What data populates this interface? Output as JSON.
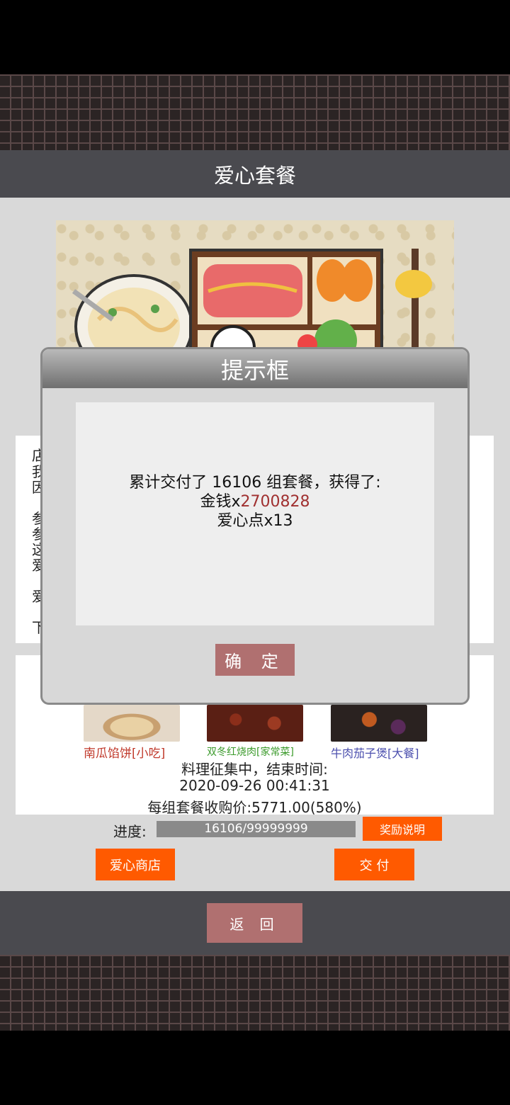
{
  "header": {
    "title": "爱心套餐"
  },
  "description_lines": [
    "店",
    "我",
    "因",
    "参",
    "参",
    "这",
    "爱",
    "爱",
    "下"
  ],
  "dishes": [
    {
      "name": "南瓜馅饼[小吃]",
      "color": "#c0392b"
    },
    {
      "name": "双冬红烧肉[家常菜]",
      "color": "#3a9a2a"
    },
    {
      "name": "牛肉茄子煲[大餐]",
      "color": "#4b4fae"
    }
  ],
  "collection": {
    "status": "料理征集中，结束时间:",
    "end_time": "2020-09-26 00:41:31",
    "price_line": "每组套餐收购价:5771.00(580%)"
  },
  "progress": {
    "label": "进度:",
    "text": "16106/99999999",
    "value": 16106,
    "max": 99999999
  },
  "buttons": {
    "reward_info": "奖励说明",
    "love_shop": "爱心商店",
    "deliver": "交 付",
    "back": "返 回"
  },
  "dialog": {
    "title": "提示框",
    "line1": "累计交付了 16106 组套餐，获得了:",
    "money_label": "金钱x",
    "money_value": "2700828",
    "love_points": "爱心点x13",
    "ok": "确 定"
  },
  "colors": {
    "accent_orange": "#ff5a00",
    "dusty_rose": "#b07070",
    "money_red": "#a03030"
  }
}
